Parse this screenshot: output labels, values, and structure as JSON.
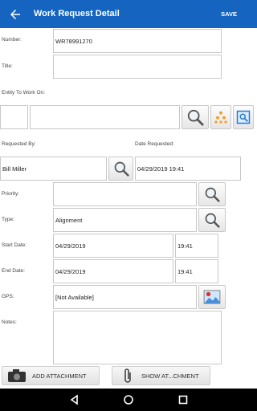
{
  "header": {
    "title": "Work Request Detail",
    "save_label": "SAVE"
  },
  "form": {
    "number": {
      "label": "Number:",
      "value": "WR78991270"
    },
    "title": {
      "label": "Title:",
      "value": ""
    },
    "entity": {
      "label": "Entity To Work On:",
      "code": "",
      "description": ""
    },
    "requested_by": {
      "label": "Requested By:",
      "value": "Bill Miller"
    },
    "date_requested": {
      "label": "Date Requested:",
      "value": "04/29/2019 19:41"
    },
    "priority": {
      "label": "Priority:",
      "value": ""
    },
    "type": {
      "label": "Type:",
      "value": "Alignment"
    },
    "start_date": {
      "label": "Start Date:",
      "date": "04/29/2019",
      "time": "19:41"
    },
    "end_date": {
      "label": "End Date:",
      "date": "04/29/2019",
      "time": "19:41"
    },
    "gps": {
      "label": "GPS:",
      "value": "[Not Available]"
    },
    "notes": {
      "label": "Notes:",
      "value": ""
    }
  },
  "actions": {
    "add_attachment": "ADD ATTACHMENT",
    "show_attachment": "SHOW AT...CHMENT"
  },
  "colors": {
    "appbar": "#1565c0",
    "navbar": "#000000"
  }
}
